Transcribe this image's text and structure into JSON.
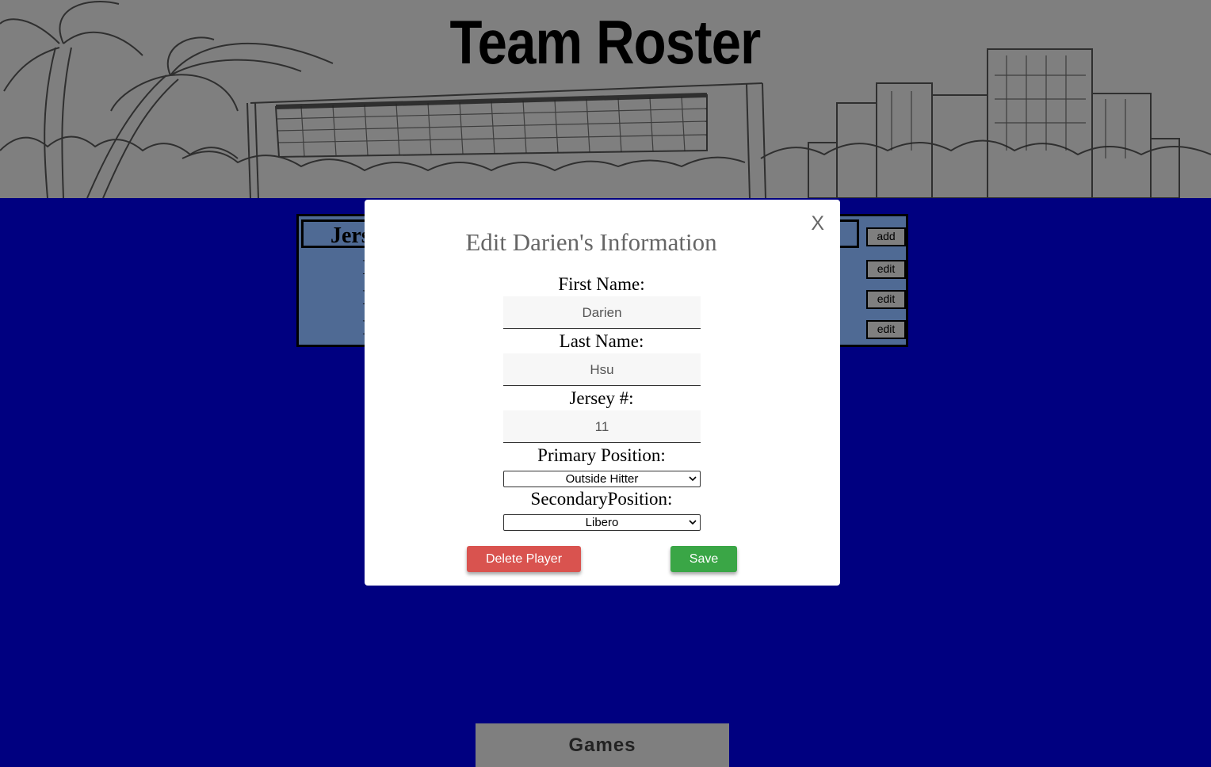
{
  "header": {
    "title": "Team Roster"
  },
  "roster": {
    "header_label": "Jers",
    "add_label": "add",
    "rows": [
      {
        "initial": "I",
        "edit_label": "edit"
      },
      {
        "initial": "I",
        "edit_label": "edit"
      },
      {
        "initial": "I",
        "edit_label": "edit"
      }
    ]
  },
  "modal": {
    "close_label": "X",
    "title": "Edit Darien's Information",
    "first_name": {
      "label": "First Name:",
      "value": "Darien"
    },
    "last_name": {
      "label": "Last Name:",
      "value": "Hsu"
    },
    "jersey": {
      "label": "Jersey #:",
      "value": "11"
    },
    "primary_position": {
      "label": "Primary Position:",
      "value": "Outside Hitter"
    },
    "secondary_position": {
      "label": "SecondaryPosition:",
      "value": "Libero"
    },
    "delete_label": "Delete Player",
    "save_label": "Save"
  },
  "footer": {
    "games_label": "Games"
  },
  "colors": {
    "page_background": "#000080",
    "header_background": "#7f7f7f",
    "delete_button": "#d9534f",
    "save_button": "#3aa646"
  }
}
